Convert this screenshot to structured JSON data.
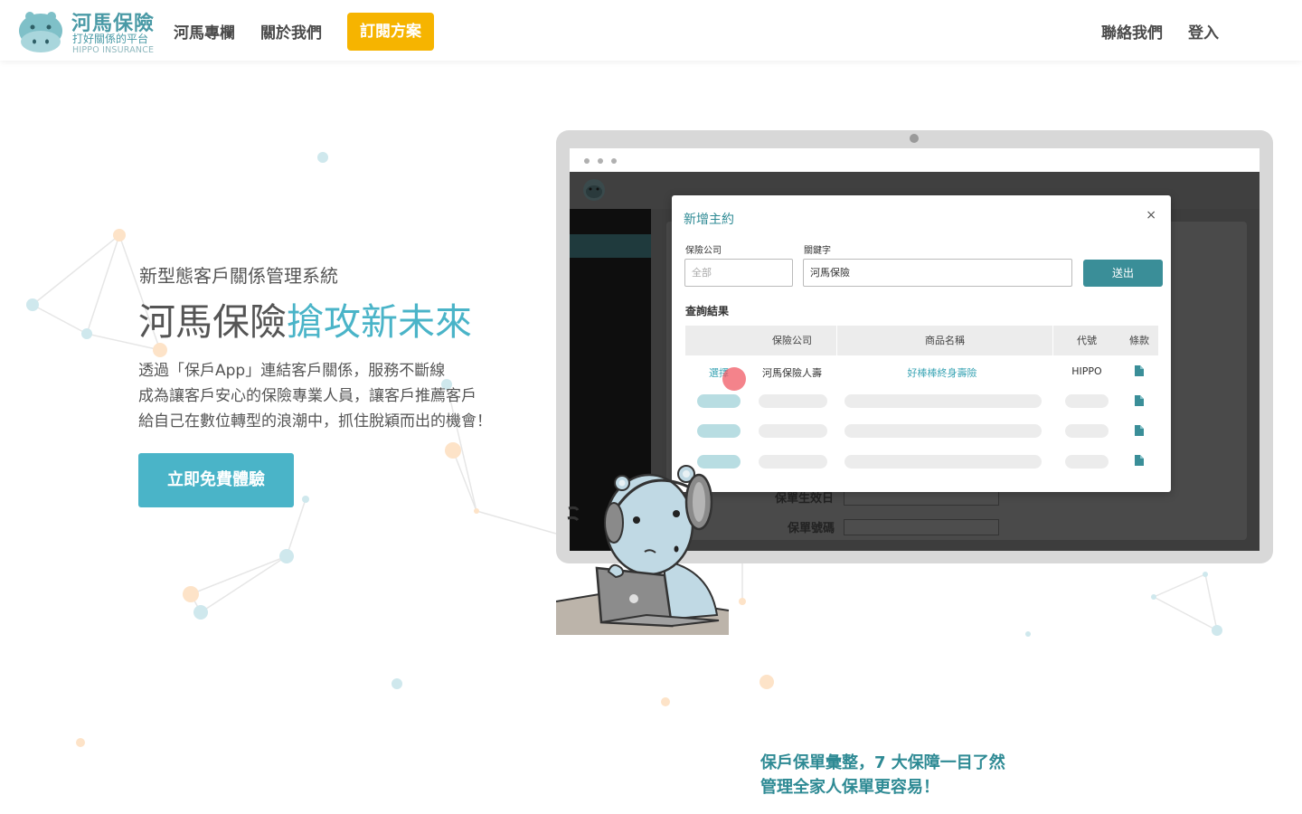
{
  "brand": {
    "name": "河馬保險",
    "tagline": "打好關係的平台",
    "english": "HIPPO INSURANCE"
  },
  "nav": {
    "links": [
      "河馬專欄",
      "關於我們"
    ],
    "cta": "訂閱方案",
    "contact": "聯絡我們",
    "login": "登入"
  },
  "hero": {
    "subtitle": "新型態客戶關係管理系統",
    "title_plain": "河馬保險",
    "title_highlight": "搶攻新未來",
    "description": [
      "透過「保戶App」連結客戶關係，服務不斷線",
      "成為讓客戶安心的保險專業人員，讓客戶推薦客戶",
      "給自己在數位轉型的浪潮中，抓住脫穎而出的機會！"
    ],
    "button": "立即免費體驗"
  },
  "demo_app": {
    "background_labels": [
      "保單生效日",
      "保單號碼"
    ],
    "modal": {
      "title": "新增主約",
      "close": "×",
      "company_label": "保險公司",
      "company_placeholder": "全部",
      "keyword_label": "關鍵字",
      "keyword_value": "河馬保險",
      "submit": "送出",
      "results_title": "查詢結果",
      "columns": [
        "保險公司",
        "商品名稱",
        "代號",
        "條款"
      ],
      "row": {
        "action": "選擇",
        "company": "河馬保險人壽",
        "product": "好棒棒終身壽險",
        "code": "HIPPO",
        "terms_icon": "document-icon"
      }
    }
  },
  "feature": {
    "lines": [
      "保戶保單彙整，7 大保障一目了然",
      "管理全家人保單更容易！"
    ]
  },
  "colors": {
    "brand_teal": "#4a9aa6",
    "accent_teal": "#4ab4c8",
    "cta_yellow": "#f6b400",
    "button_teal": "#3a8e98"
  }
}
